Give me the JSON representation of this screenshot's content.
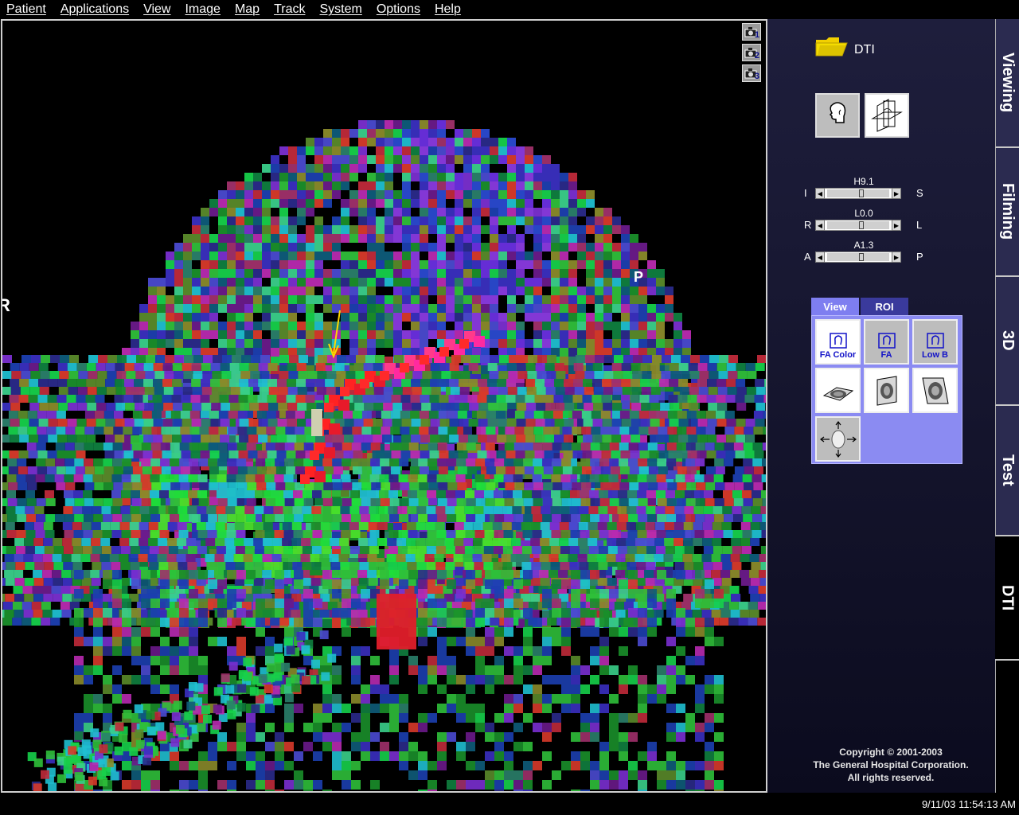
{
  "menu": [
    "Patient",
    "Applications",
    "View",
    "Image",
    "Map",
    "Track",
    "System",
    "Options",
    "Help"
  ],
  "viewport": {
    "orientation_left": "R",
    "orientation_right": "P",
    "camera_buttons": [
      "1",
      "2",
      "3"
    ]
  },
  "panel": {
    "title": "DTI",
    "sliders": [
      {
        "value": "H9.1",
        "left": "I",
        "right": "S",
        "position": 0.56
      },
      {
        "value": "L0.0",
        "left": "R",
        "right": "L",
        "position": 0.56
      },
      {
        "value": "A1.3",
        "left": "A",
        "right": "P",
        "position": 0.56
      }
    ],
    "tabs": [
      "View",
      "ROI"
    ],
    "view_buttons": [
      "FA Color",
      "FA",
      "Low B"
    ],
    "copyright": [
      "Copyright © 2001-2003",
      "The General Hospital Corporation.",
      "All rights reserved."
    ]
  },
  "side_tabs": [
    "Viewing",
    "Filming",
    "3D",
    "Test",
    "DTI"
  ],
  "status": {
    "datetime": "9/11/03 11:54:13 AM"
  },
  "icons": {
    "camera": "camera-icon",
    "folder": "folder-icon",
    "head": "head-outline-icon",
    "planes": "orthogonal-planes-icon",
    "arrow_left": "arrow-left-icon",
    "arrow_right": "arrow-right-icon",
    "navigate": "navigate-head-icon"
  },
  "colors": {
    "tab_active": "#7e7ef0",
    "tab_inactive": "#3a3a9c",
    "panel_bg": "#1e1e3c",
    "button_label": "#1212c8",
    "annotation_arrow": "#ffd800"
  }
}
